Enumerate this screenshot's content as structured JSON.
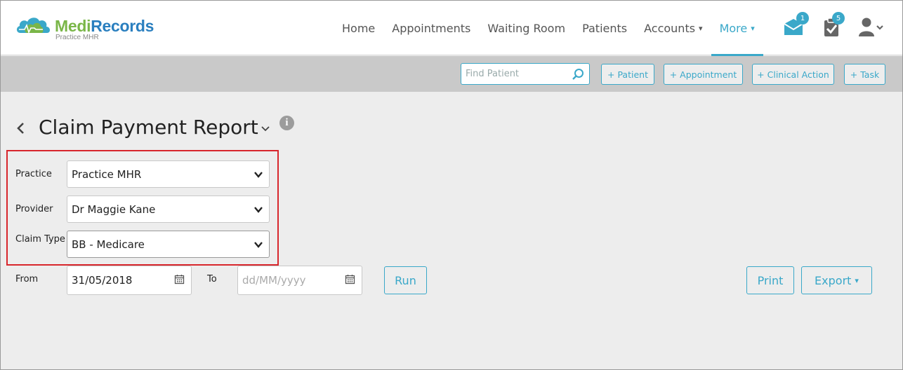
{
  "app": {
    "logo_part1": "Medi",
    "logo_part2": "Records",
    "logo_subtitle": "Practice MHR",
    "colors": {
      "accent": "#3aa8c9",
      "logo_green": "#7ab648",
      "logo_blue": "#2a7fbf",
      "highlight": "#d8262c"
    }
  },
  "nav": {
    "items": [
      {
        "label": "Home"
      },
      {
        "label": "Appointments"
      },
      {
        "label": "Waiting Room"
      },
      {
        "label": "Patients"
      },
      {
        "label": "Accounts",
        "chevron": "▾"
      },
      {
        "label": "More",
        "chevron": "▾",
        "active": true
      }
    ],
    "messages_badge": "1",
    "tasks_badge": "5",
    "icons": [
      "envelope-icon",
      "clipboard-check-icon",
      "user-icon"
    ]
  },
  "actionbar": {
    "find_placeholder": "Find Patient",
    "buttons": [
      "+ Patient",
      "+ Appointment",
      "+ Clinical Action",
      "+ Task"
    ]
  },
  "page": {
    "title": "Claim Payment Report",
    "info_glyph": "i"
  },
  "filters": {
    "practice_label": "Practice",
    "practice_value": "Practice MHR",
    "provider_label": "Provider",
    "provider_value": "Dr Maggie Kane",
    "claim_type_label": "Claim Type",
    "claim_type_value": "BB - Medicare",
    "from_label": "From",
    "from_value": "31/05/2018",
    "to_label": "To",
    "to_placeholder": "dd/MM/yyyy"
  },
  "actions": {
    "run_label": "Run",
    "print_label": "Print",
    "export_label": "Export",
    "export_chevron": "▾"
  }
}
